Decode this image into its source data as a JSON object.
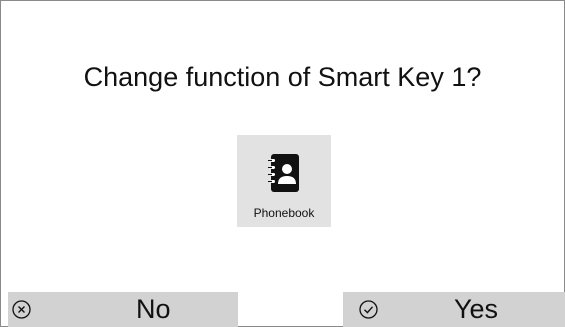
{
  "dialog": {
    "question": "Change function of Smart Key 1?"
  },
  "option": {
    "icon": "phonebook-icon",
    "label": "Phonebook"
  },
  "softkeys": {
    "no": {
      "icon": "cancel-circle-x-icon",
      "label": "No"
    },
    "yes": {
      "icon": "confirm-circle-check-icon",
      "label": "Yes"
    }
  }
}
